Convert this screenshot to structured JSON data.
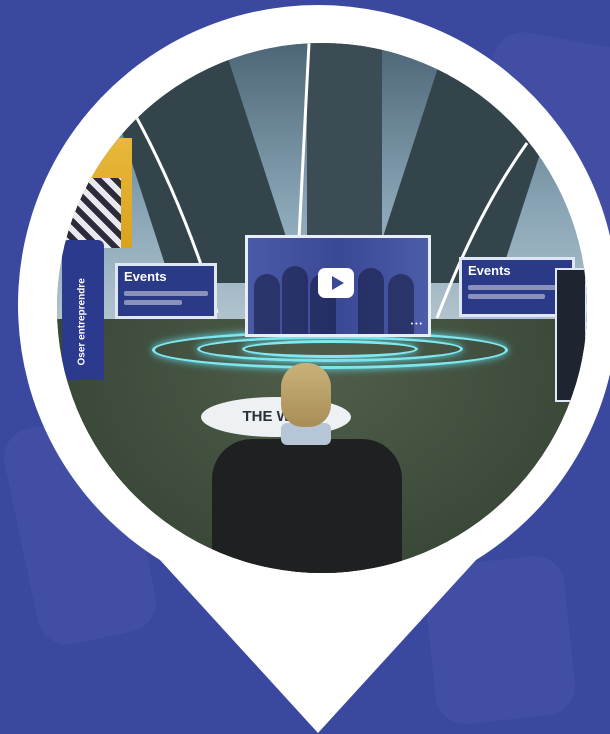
{
  "colors": {
    "background": "#3b48a0",
    "pin": "#ffffff",
    "accent_glow": "#7fe8f0",
    "panel": "#2a3a86"
  },
  "scene": {
    "left_panel": {
      "title": "Events"
    },
    "right_panel": {
      "title": "Events"
    },
    "totem": {
      "label": "Oser entreprendre"
    },
    "video": {
      "icon": "play-icon"
    },
    "floor_logo": {
      "text": "THE WAY"
    }
  }
}
